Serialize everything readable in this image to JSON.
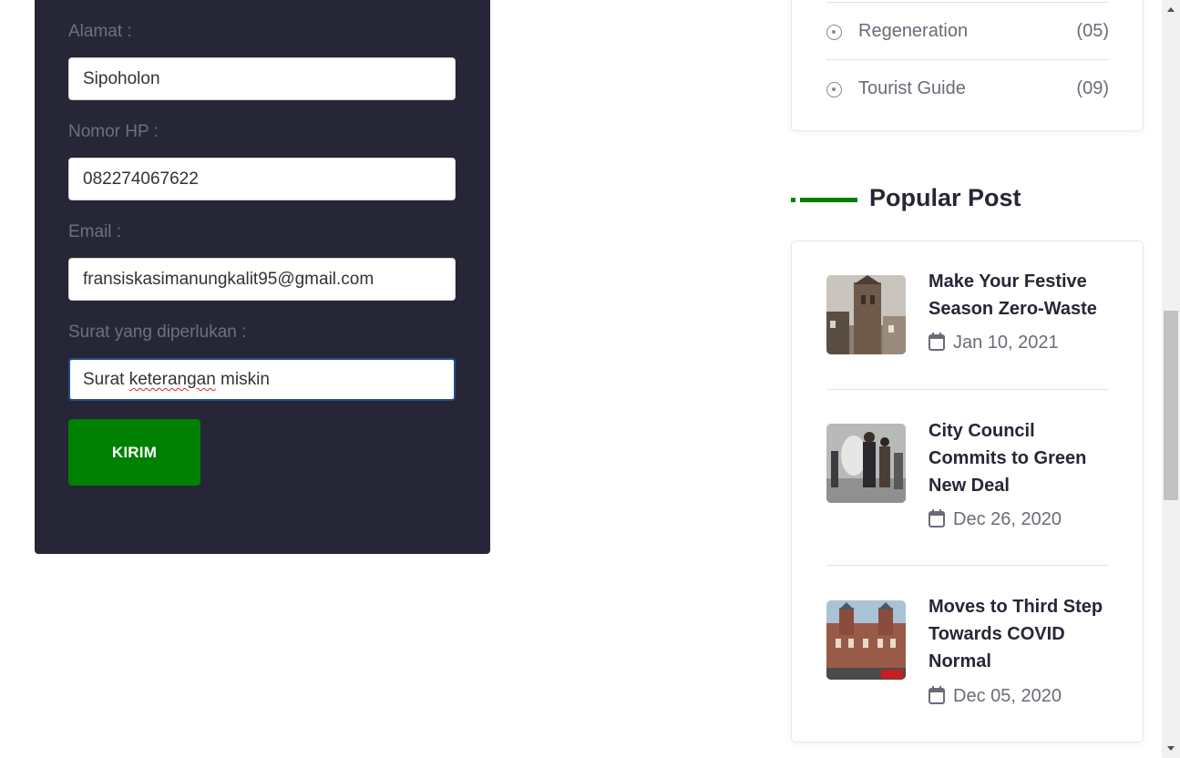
{
  "form": {
    "address_label": "Alamat :",
    "address_value": "Sipoholon",
    "phone_label": "Nomor HP :",
    "phone_value": "082274067622",
    "email_label": "Email :",
    "email_value": "fransiskasimanungkalit95@gmail.com",
    "letter_label": "Surat yang diperlukan :",
    "letter_value_start": "Surat ",
    "letter_value_misspelled": "keterangan",
    "letter_value_end": " miskin",
    "submit_label": "KIRIM"
  },
  "categories": [
    {
      "name": "Regeneration",
      "count": "(05)"
    },
    {
      "name": "Tourist Guide",
      "count": "(09)"
    }
  ],
  "popular_post": {
    "heading": "Popular Post",
    "posts": [
      {
        "title": "Make Your Festive Season Zero-Waste",
        "date": "Jan 10, 2021"
      },
      {
        "title": "City Council Commits to Green New Deal",
        "date": "Dec 26, 2020"
      },
      {
        "title": "Moves to Third Step Towards COVID Normal",
        "date": "Dec 05, 2020"
      }
    ]
  },
  "colors": {
    "panel_bg": "#262637",
    "accent_green": "#008000",
    "muted_text": "#6b6b78"
  }
}
